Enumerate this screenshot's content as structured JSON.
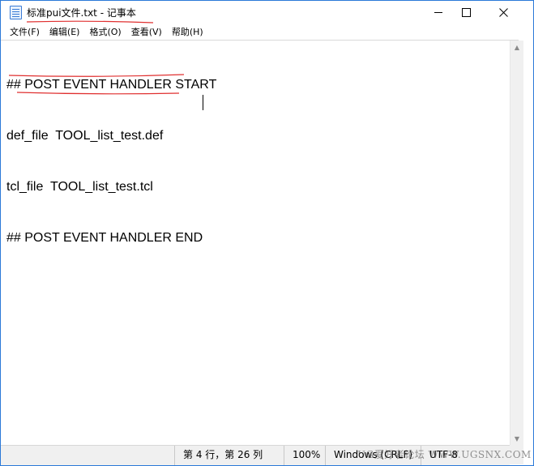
{
  "window": {
    "title": "标准pui文件.txt - 记事本"
  },
  "menu": [
    "文件(F)",
    "编辑(E)",
    "格式(O)",
    "查看(V)",
    "帮助(H)"
  ],
  "editor": {
    "lines": [
      "## POST EVENT HANDLER START",
      "def_file  TOOL_list_test.def",
      "tcl_file  TOOL_list_test.tcl",
      "## POST EVENT HANDLER END"
    ]
  },
  "status": {
    "position": "第 4 行，第 26 列",
    "zoom": "100%",
    "line_ending": "Windows (CRLF)",
    "encoding": "UTF-8"
  },
  "watermark": "UG爱好者论坛  WWW.UGSNX.COM",
  "colors": {
    "annotation": "#e03030",
    "accent": "#2b79d8"
  }
}
